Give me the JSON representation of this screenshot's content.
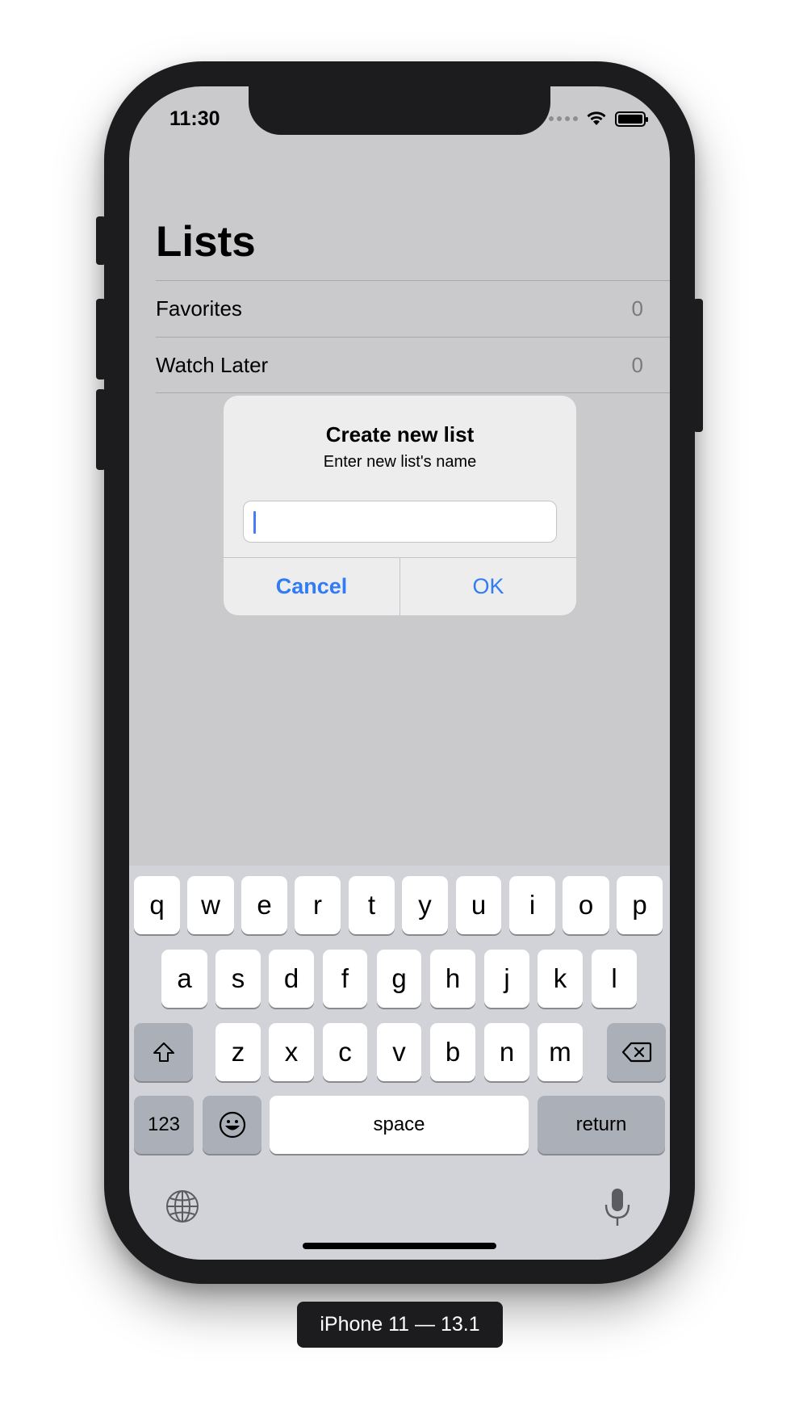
{
  "device": {
    "caption": "iPhone 11 — 13.1"
  },
  "status_bar": {
    "time": "11:30"
  },
  "navigation": {
    "title": "Lists"
  },
  "lists": [
    {
      "label": "Favorites",
      "count": "0"
    },
    {
      "label": "Watch Later",
      "count": "0"
    }
  ],
  "alert": {
    "title": "Create new list",
    "message": "Enter new list's name",
    "field_value": "",
    "cancel_label": "Cancel",
    "ok_label": "OK"
  },
  "keyboard": {
    "row1": [
      "q",
      "w",
      "e",
      "r",
      "t",
      "y",
      "u",
      "i",
      "o",
      "p"
    ],
    "row2": [
      "a",
      "s",
      "d",
      "f",
      "g",
      "h",
      "j",
      "k",
      "l"
    ],
    "row3": [
      "z",
      "x",
      "c",
      "v",
      "b",
      "n",
      "m"
    ],
    "numbers_label": "123",
    "space_label": "space",
    "return_label": "return"
  },
  "colors": {
    "accent": "#2f7cf6",
    "dimmed_background": "#cacacc",
    "keyboard_background": "#d1d3d9"
  }
}
